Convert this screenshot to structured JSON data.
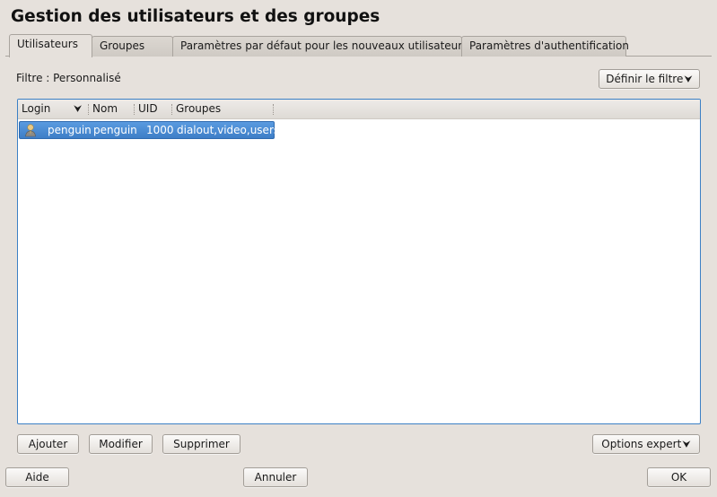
{
  "window": {
    "title": "Gestion des utilisateurs et des groupes"
  },
  "tabs": [
    {
      "label": "Utilisateurs",
      "active": true
    },
    {
      "label": "Groupes",
      "active": false
    },
    {
      "label": "Paramètres par défaut pour les nouveaux utilisateurs",
      "active": false
    },
    {
      "label": "Paramètres d'authentification",
      "active": false
    }
  ],
  "filter": {
    "label": "Filtre : Personnalisé",
    "button_label": "Définir le filtre"
  },
  "table": {
    "columns": [
      "Login",
      "Nom",
      "UID",
      "Groupes"
    ],
    "rows": [
      {
        "icon": "user-icon",
        "login": "penguin",
        "name": "penguin",
        "uid": "1000",
        "groups": "dialout,video,users",
        "selected": true
      }
    ]
  },
  "actions": {
    "add": "Ajouter",
    "edit": "Modifier",
    "delete": "Supprimer",
    "expert": "Options expert"
  },
  "footer": {
    "help": "Aide",
    "cancel": "Annuler",
    "ok": "OK"
  },
  "colors": {
    "selection": "#3e7ec7",
    "focus_border": "#3c80c5",
    "background": "#e6e1dc"
  }
}
